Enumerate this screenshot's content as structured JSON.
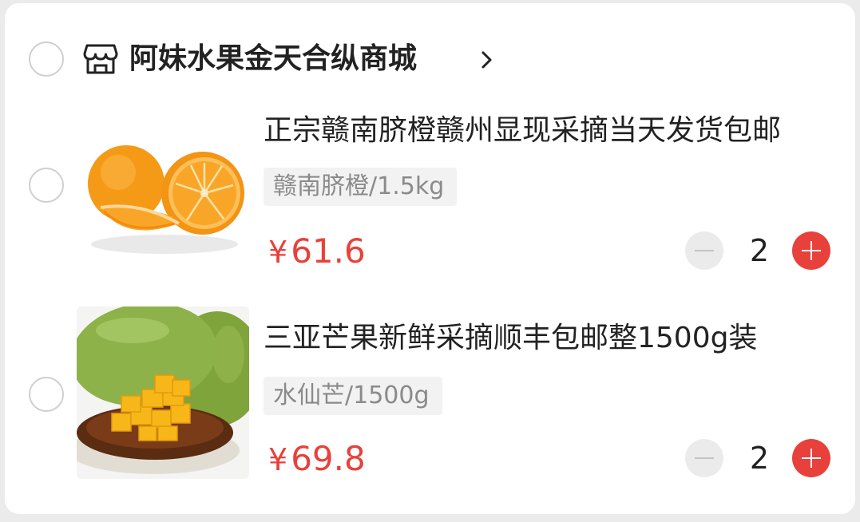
{
  "store": {
    "name": "阿妹水果金天合纵商城",
    "icon": "store-icon",
    "chevron_icon": "chevron-right-icon"
  },
  "colors": {
    "price": "#e8413b",
    "plus_button": "#e8413b",
    "minus_button": "#ebebeb"
  },
  "items": [
    {
      "title": "正宗赣南脐橙赣州显现采摘当天发货包邮",
      "spec": "赣南脐橙/1.5kg",
      "currency": "¥",
      "price": "61.6",
      "quantity": "2",
      "image": "orange-image"
    },
    {
      "title": "三亚芒果新鲜采摘顺丰包邮整1500g装",
      "spec": "水仙芒/1500g",
      "currency": "¥",
      "price": "69.8",
      "quantity": "2",
      "image": "mango-image"
    }
  ]
}
